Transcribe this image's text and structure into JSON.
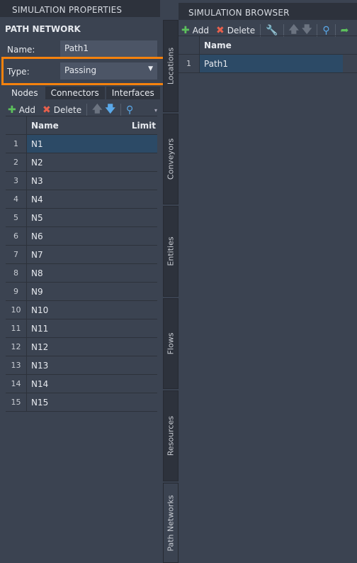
{
  "properties": {
    "header": "SIMULATION PROPERTIES",
    "title": "PATH NETWORK",
    "name_label": "Name:",
    "name_value": "Path1",
    "type_label": "Type:",
    "type_value": "Passing",
    "tabs": [
      "Nodes",
      "Connectors",
      "Interfaces"
    ],
    "toolbar": {
      "add": "Add",
      "delete": "Delete"
    },
    "columns": {
      "name": "Name",
      "limit": "Limit"
    },
    "rows": [
      {
        "n": "1",
        "name": "N1"
      },
      {
        "n": "2",
        "name": "N2"
      },
      {
        "n": "3",
        "name": "N3"
      },
      {
        "n": "4",
        "name": "N4"
      },
      {
        "n": "5",
        "name": "N5"
      },
      {
        "n": "6",
        "name": "N6"
      },
      {
        "n": "7",
        "name": "N7"
      },
      {
        "n": "8",
        "name": "N8"
      },
      {
        "n": "9",
        "name": "N9"
      },
      {
        "n": "10",
        "name": "N10"
      },
      {
        "n": "11",
        "name": "N11"
      },
      {
        "n": "12",
        "name": "N12"
      },
      {
        "n": "13",
        "name": "N13"
      },
      {
        "n": "14",
        "name": "N14"
      },
      {
        "n": "15",
        "name": "N15"
      }
    ]
  },
  "side_tabs": [
    "Locations",
    "Conveyors",
    "Entities",
    "Flows",
    "Resources",
    "Path Networks"
  ],
  "browser": {
    "header": "SIMULATION BROWSER",
    "toolbar": {
      "add": "Add",
      "delete": "Delete"
    },
    "column": "Name",
    "rows": [
      {
        "n": "1",
        "name": "Path1"
      }
    ]
  },
  "colors": {
    "highlight": "#f5820d",
    "selected_row": "#2c4a66"
  }
}
